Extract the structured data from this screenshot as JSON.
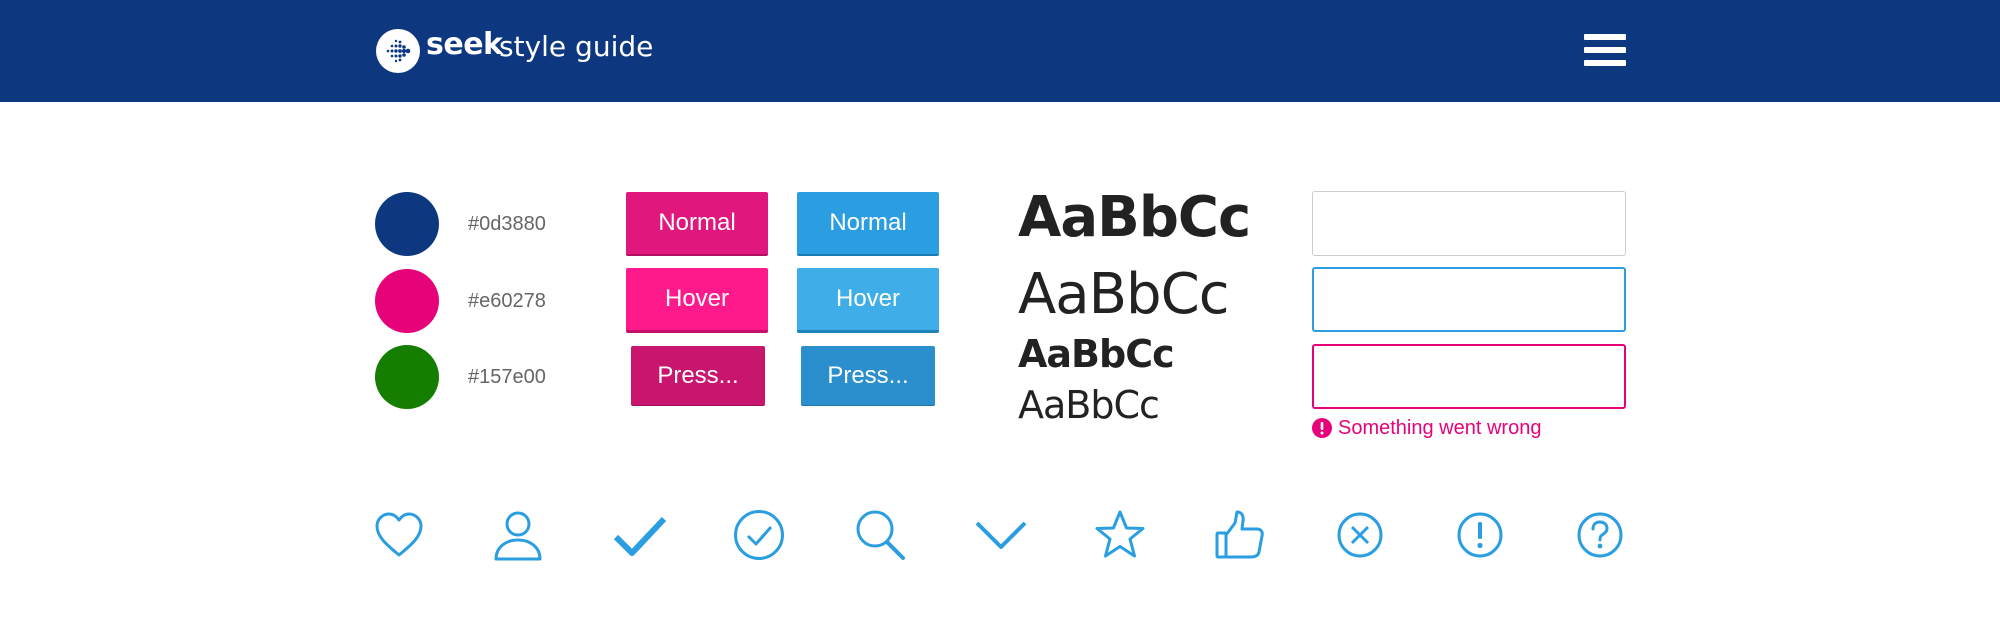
{
  "header": {
    "brand": "seek",
    "subtitle": "style guide",
    "menu_icon": "hamburger-menu-icon",
    "logo_icon": "seek-logo-icon"
  },
  "colors": [
    {
      "hex": "#0d3880"
    },
    {
      "hex": "#e60278"
    },
    {
      "hex": "#157e00"
    }
  ],
  "buttons": {
    "pink": {
      "normal": "Normal",
      "hover": "Hover",
      "pressed": "Press..."
    },
    "blue": {
      "normal": "Normal",
      "hover": "Hover",
      "pressed": "Press..."
    },
    "pink_colors": {
      "normal": "#e0177c",
      "hover": "#ff1a8c",
      "pressed": "#c8166f"
    },
    "blue_colors": {
      "normal": "#2a9ee0",
      "hover": "#3faee8",
      "pressed": "#2a8fcc"
    }
  },
  "typography": {
    "samples": [
      "AaBbCc",
      "AaBbCc",
      "AaBbCc",
      "AaBbCc"
    ]
  },
  "form": {
    "error_message": "Something went wrong",
    "border_colors": {
      "default": "#cccccc",
      "focus": "#2a9ee0",
      "error": "#e60278"
    }
  },
  "icons": [
    "heart-icon",
    "user-icon",
    "check-icon",
    "check-circle-icon",
    "search-icon",
    "chevron-down-icon",
    "star-icon",
    "thumbs-up-icon",
    "close-circle-icon",
    "alert-circle-icon",
    "help-circle-icon"
  ],
  "accent": "#2a9ee0"
}
